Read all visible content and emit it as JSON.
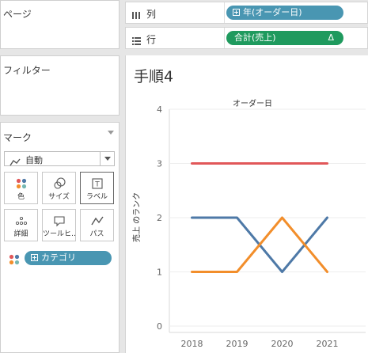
{
  "left_panel": {
    "pages_label": "ページ",
    "filters_label": "フィルター",
    "marks": {
      "title": "マーク",
      "mark_type": "自動",
      "buttons": [
        {
          "label": "色",
          "icon": "color-dots-icon"
        },
        {
          "label": "サイズ",
          "icon": "size-icon"
        },
        {
          "label": "ラベル",
          "icon": "label-icon"
        },
        {
          "label": "詳細",
          "icon": "detail-dots-icon"
        },
        {
          "label": "ツールヒ…",
          "icon": "tooltip-icon"
        },
        {
          "label": "パス",
          "icon": "path-icon"
        }
      ],
      "color_field": "カテゴリ"
    }
  },
  "shelves": {
    "columns": {
      "label": "列",
      "pill": "年(オーダー日)"
    },
    "rows": {
      "label": "行",
      "pill": "合計(売上)",
      "pill_suffix": "Δ"
    }
  },
  "sheet": {
    "title": "手順4"
  },
  "chart_data": {
    "type": "line",
    "title": "オーダー日",
    "xlabel": "",
    "ylabel": "売上 のランク",
    "categories": [
      "2018",
      "2019",
      "2020",
      "2021"
    ],
    "ylim": [
      0,
      4
    ],
    "yticks": [
      "0",
      "1",
      "2",
      "3",
      "4"
    ],
    "grid": true,
    "series": [
      {
        "color": "#e15759",
        "values": [
          3,
          3,
          3,
          3
        ]
      },
      {
        "color": "#4e79a7",
        "values": [
          2,
          2,
          1,
          2
        ]
      },
      {
        "color": "#f28e2b",
        "values": [
          1,
          1,
          2,
          1
        ]
      }
    ]
  },
  "colors": {
    "dimension_pill": "#4996b2",
    "measure_pill": "#1f9a5e"
  }
}
